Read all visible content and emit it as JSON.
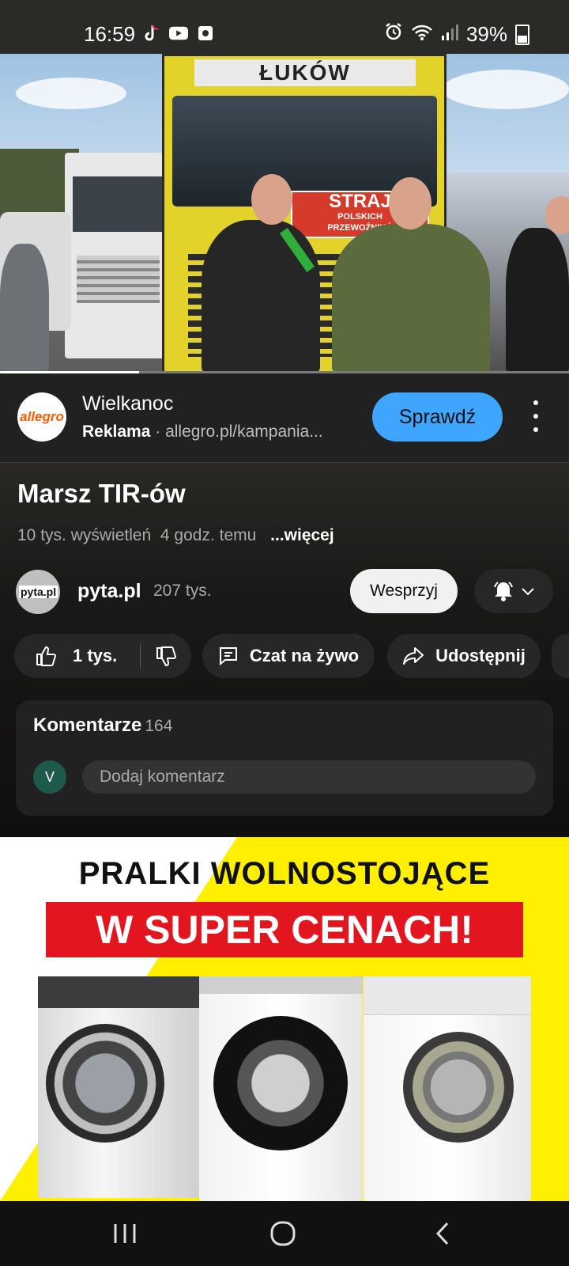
{
  "status_bar": {
    "time": "16:59",
    "battery": "39%",
    "left_icons": [
      "tiktok-icon",
      "youtube-icon",
      "notification-icon"
    ],
    "right_icons": [
      "alarm-icon",
      "wifi-icon",
      "signal-icon",
      "battery-icon"
    ]
  },
  "video": {
    "truck_sign": "ŁUKÓW",
    "banner_text_1": "STRAJ",
    "banner_text_2": "POLSKICH",
    "banner_text_3": "PRZEWOŹNIKÓ",
    "progress_fraction": 0.245
  },
  "ad": {
    "logo_text": "allegro",
    "title": "Wielkanoc",
    "label": "Reklama",
    "separator": "·",
    "url": "allegro.pl/kampania...",
    "button": "Sprawdź"
  },
  "video_info": {
    "title": "Marsz TIR-ów",
    "views": "10 tys. wyświetleń",
    "age": "4 godz. temu",
    "more": "...więcej"
  },
  "channel": {
    "avatar_text": "pyta.pl",
    "name": "pyta.pl",
    "subscribers": "207 tys.",
    "support_button": "Wesprzyj"
  },
  "actions": {
    "likes": "1 tys.",
    "live_chat": "Czat na żywo",
    "share": "Udostępnij"
  },
  "comments": {
    "title": "Komentarze",
    "count": "164",
    "user_initial": "V",
    "placeholder": "Dodaj komentarz"
  },
  "banner_ad": {
    "line1": "PRALKI WOLNOSTOJĄCE",
    "line2": "W SUPER CENACH!",
    "colors": {
      "background": "#ffef00",
      "highlight": "#e3151f"
    }
  },
  "nav": [
    "recent-apps-icon",
    "home-icon",
    "back-icon"
  ]
}
